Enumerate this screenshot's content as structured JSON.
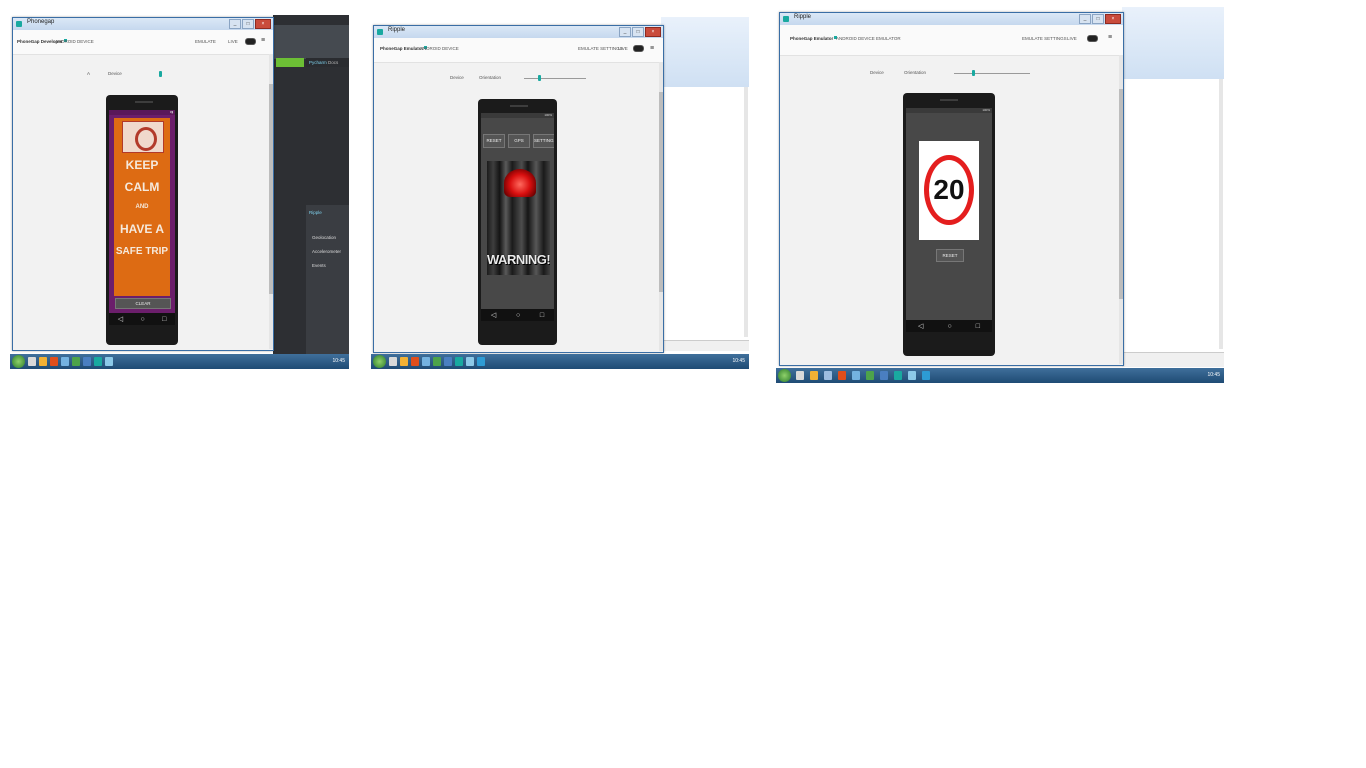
{
  "screenshots": [
    {
      "window_title": "Phonegap",
      "toolbar": {
        "left_label": "PhoneGap Developer",
        "tab_label": "ANDROID DEVICE",
        "right_label": "EMULATE",
        "toggle_label": "LIVE"
      },
      "subbar": {
        "left_label": "A",
        "right_label": "Device"
      },
      "poster": {
        "line1": "KEEP",
        "line2": "CALM",
        "line3": "AND",
        "line4": "HAVE A",
        "line5": "SAFE TRIP"
      },
      "phone_button": "CLEAR",
      "side_panel": {
        "tab1": "Pycharm",
        "tab2": "Docs",
        "section": "Ripple",
        "items": [
          "Geolocation",
          "Accelerometer",
          "Events"
        ]
      }
    },
    {
      "window_title": "Ripple",
      "toolbar": {
        "left_label": "PhoneGap Emulator",
        "tab_label": "ANDROID DEVICE",
        "right_label": "EMULATE SETTINGS",
        "toggle_label": "LIVE"
      },
      "subbar": {
        "left_label": "Device",
        "right_label": "Orientation"
      },
      "phone_buttons": [
        "RESET",
        "GPS",
        "SETTINGS"
      ],
      "warning_text": "WARNING!",
      "status_text": "100%"
    },
    {
      "window_title": "Ripple",
      "toolbar": {
        "left_label": "PhoneGap Emulator",
        "tab_label": "ANDROID DEVICE EMULATOR",
        "right_label": "EMULATE SETTINGS",
        "toggle_label": "LIVE"
      },
      "subbar": {
        "left_label": "Device",
        "right_label": "Orientation"
      },
      "speed_limit": "20",
      "reset_button": "RESET",
      "status_text": "100%"
    }
  ],
  "taskbar": {
    "time": "10:45"
  },
  "colors": {
    "accent": "#19a9a0",
    "poster": "#dd6b13",
    "sign_ring": "#e41e1e",
    "taskbar": "#1f4b74"
  }
}
